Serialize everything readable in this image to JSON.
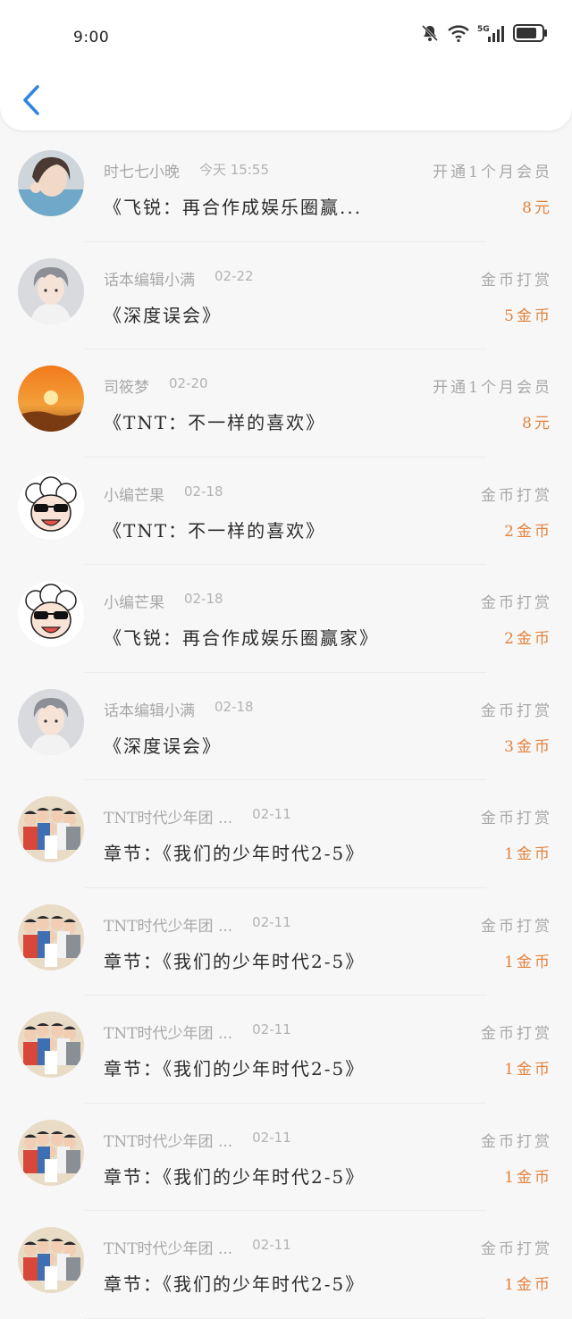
{
  "status_bar": {
    "time": "9:00",
    "network": "5G"
  },
  "colors": {
    "accent_back": "#2e86de",
    "reward": "#e3833c"
  },
  "items": [
    {
      "name": "时七七小晚",
      "date": "今天 15:55",
      "title": "《飞锐：再合作成娱乐圈赢...",
      "reward_label": "开通1个月会员",
      "reward_amount": "8元",
      "avatar": "photo-girl"
    },
    {
      "name": "话本编辑小满",
      "date": "02-22",
      "title": "《深度误会》",
      "reward_label": "金币打赏",
      "reward_amount": "5金币",
      "avatar": "anime-boy"
    },
    {
      "name": "司筱梦",
      "date": "02-20",
      "title": "《TNT：不一样的喜欢》",
      "reward_label": "开通1个月会员",
      "reward_amount": "8元",
      "avatar": "sunset"
    },
    {
      "name": "小编芒果",
      "date": "02-18",
      "title": "《TNT：不一样的喜欢》",
      "reward_label": "金币打赏",
      "reward_amount": "2金币",
      "avatar": "sheep"
    },
    {
      "name": "小编芒果",
      "date": "02-18",
      "title": "《飞锐：再合作成娱乐圈赢家》",
      "reward_label": "金币打赏",
      "reward_amount": "2金币",
      "avatar": "sheep"
    },
    {
      "name": "话本编辑小满",
      "date": "02-18",
      "title": "《深度误会》",
      "reward_label": "金币打赏",
      "reward_amount": "3金币",
      "avatar": "anime-boy"
    },
    {
      "name": "TNT时代少年团 ...",
      "date": "02-11",
      "title": "章节：《我们的少年时代2-5》",
      "reward_label": "金币打赏",
      "reward_amount": "1金币",
      "avatar": "group"
    },
    {
      "name": "TNT时代少年团 ...",
      "date": "02-11",
      "title": "章节：《我们的少年时代2-5》",
      "reward_label": "金币打赏",
      "reward_amount": "1金币",
      "avatar": "group"
    },
    {
      "name": "TNT时代少年团 ...",
      "date": "02-11",
      "title": "章节：《我们的少年时代2-5》",
      "reward_label": "金币打赏",
      "reward_amount": "1金币",
      "avatar": "group"
    },
    {
      "name": "TNT时代少年团 ...",
      "date": "02-11",
      "title": "章节：《我们的少年时代2-5》",
      "reward_label": "金币打赏",
      "reward_amount": "1金币",
      "avatar": "group"
    },
    {
      "name": "TNT时代少年团 ...",
      "date": "02-11",
      "title": "章节：《我们的少年时代2-5》",
      "reward_label": "金币打赏",
      "reward_amount": "1金币",
      "avatar": "group"
    }
  ]
}
